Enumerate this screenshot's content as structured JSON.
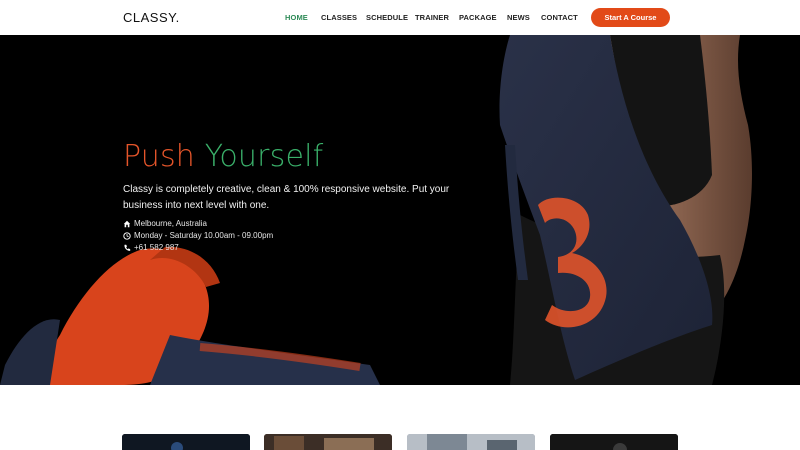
{
  "brand": {
    "logo_text": "CLASSY."
  },
  "nav": {
    "items": [
      {
        "label": "HOME",
        "active": true
      },
      {
        "label": "CLASSES",
        "active": false
      },
      {
        "label": "SCHEDULE",
        "active": false
      },
      {
        "label": "TRAINER",
        "active": false
      },
      {
        "label": "PACKAGE",
        "active": false
      },
      {
        "label": "NEWS",
        "active": false
      },
      {
        "label": "CONTACT",
        "active": false
      }
    ],
    "cta_label": "Start A Course"
  },
  "hero": {
    "title_word_1": "Push",
    "title_word_2": "Yourself",
    "description": "Classy is completely creative, clean & 100% responsive website. Put your business into next level with one.",
    "location": "Melbourne, Australia",
    "hours": "Monday - Saturday 10.00am - 09.00pm",
    "phone": "+61 582 987",
    "location_icon": "home-icon",
    "hours_icon": "clock-icon",
    "phone_icon": "phone-icon"
  },
  "colors": {
    "accent_orange": "#e24a18",
    "accent_green": "#3ab06a",
    "active_nav": "#2e8b57",
    "hero_bg": "#000000"
  }
}
